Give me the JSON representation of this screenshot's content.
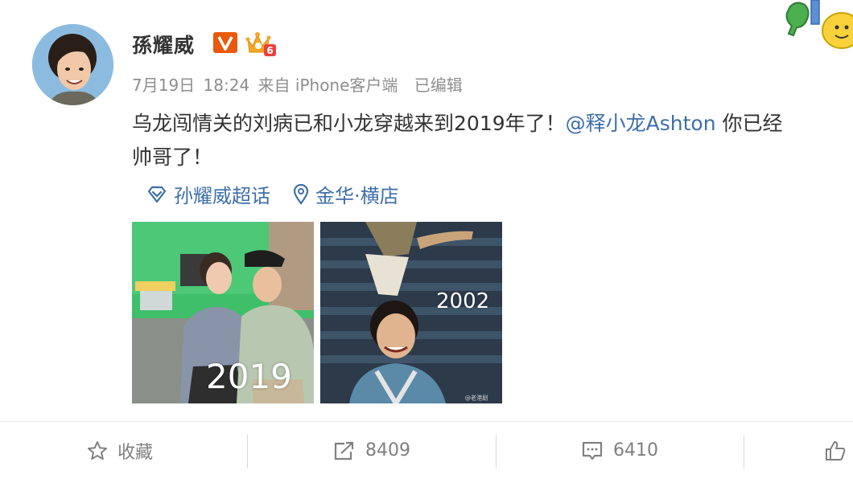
{
  "post": {
    "author": {
      "name": "孫耀威",
      "verified_icon": "verified-v-icon",
      "vip_icon": "vip-crown-icon",
      "vip_level": "6"
    },
    "meta": {
      "date": "7月19日",
      "time": "18:24",
      "source": "来自 iPhone客户端",
      "edited": "已编辑"
    },
    "text": {
      "line1_before": "乌龙闯情关的刘病已和小龙穿越来到2019年了！",
      "mention": "@释小龙Ashton",
      "line1_after": " 你已经",
      "line2": "帅哥了！"
    },
    "tags": {
      "topic": "孙耀威超话",
      "topic_icon": "supertopic-diamond-icon",
      "location": "金华·横店",
      "location_icon": "location-pin-icon"
    },
    "photos": [
      {
        "label": "2019"
      },
      {
        "label": "2002",
        "watermark": "@老港剧"
      }
    ]
  },
  "actions": {
    "favorite": {
      "icon": "star-icon",
      "label": "收藏"
    },
    "repost": {
      "icon": "repost-icon",
      "count": "8409"
    },
    "comment": {
      "icon": "comment-icon",
      "count": "6410"
    },
    "like": {
      "icon": "thumbs-up-icon"
    }
  },
  "colors": {
    "link": "#3d6fa8",
    "meta": "#8e8e8e",
    "text": "#333333",
    "action": "#808080",
    "verified": "#e85a0c",
    "vip": "#f5a623"
  }
}
